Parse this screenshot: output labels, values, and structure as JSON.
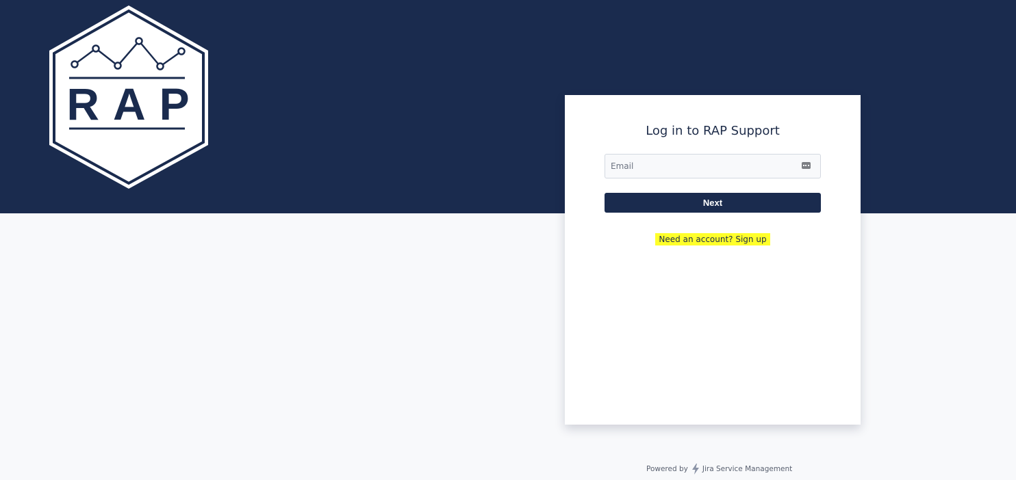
{
  "brand": {
    "logo_text": "RAP",
    "colors": {
      "navy": "#1a2b4e",
      "highlight": "#ffff2a",
      "background": "#f8f9fb"
    }
  },
  "login": {
    "title": "Log in to RAP Support",
    "email_placeholder": "Email",
    "email_value": "",
    "autofill_icon": "password-manager-icon",
    "next_label": "Next",
    "signup_text": "Need an account? Sign up"
  },
  "footer": {
    "powered_by": "Powered by",
    "product_icon": "jira-bolt-icon",
    "product_name": "Jira Service Management"
  }
}
